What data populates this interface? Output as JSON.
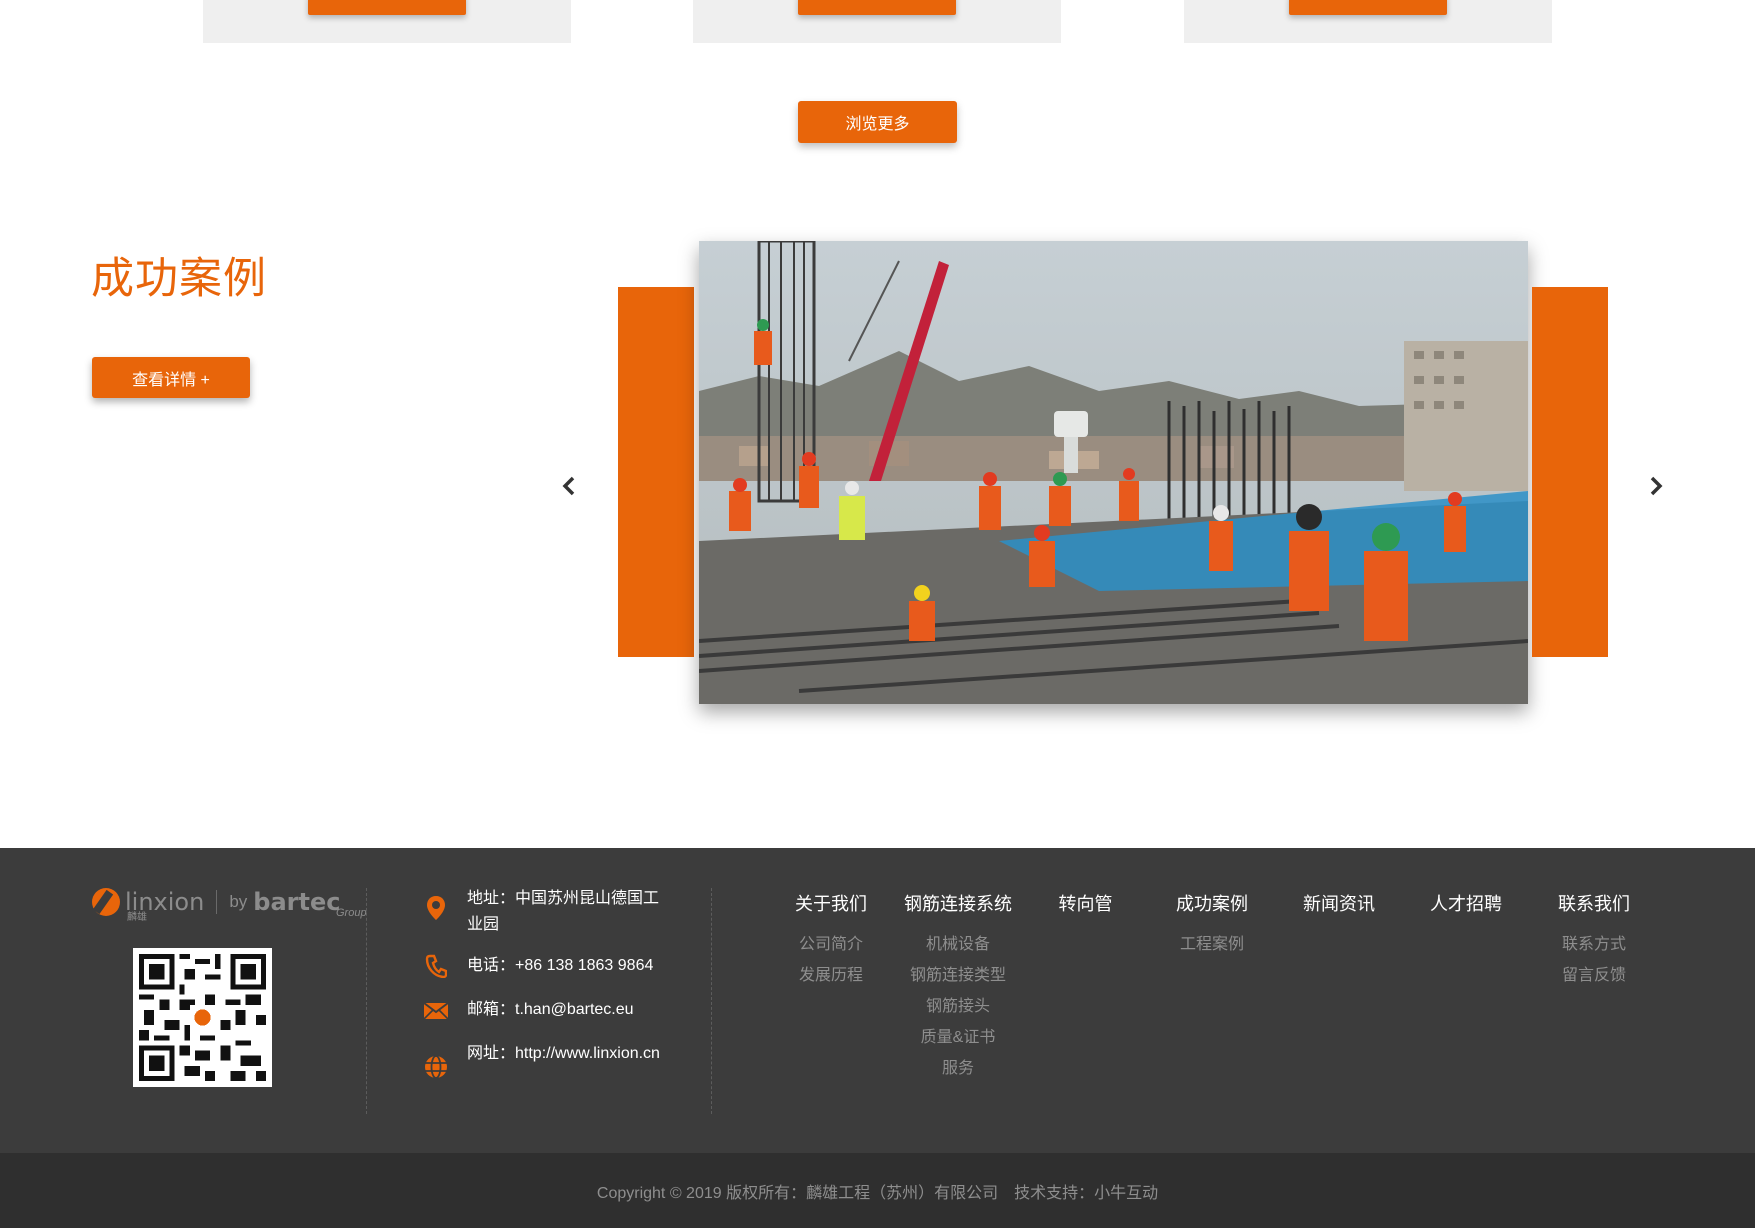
{
  "top_cards": {
    "buttons": [
      "",
      "",
      ""
    ]
  },
  "browse_more_label": "浏览更多",
  "cases": {
    "title": "成功案例",
    "details_label": "查看详情 +",
    "prev_icon": "chevron-left-icon",
    "next_icon": "chevron-right-icon",
    "slide_description_icon": "construction-site-photo"
  },
  "footer": {
    "logo": {
      "brand": "linxion",
      "brand_sub": "麟雄",
      "by": "by",
      "partner": "bartec",
      "partner_sub": "Group"
    },
    "contact": {
      "address": "地址：中国苏州昆山德国工业园",
      "phone": "电话：+86 138 1863 9864",
      "email": "邮箱：t.han@bartec.eu",
      "website": "网址：http://www.linxion.cn"
    },
    "nav": [
      {
        "label": "关于我们",
        "items": [
          "公司简介",
          "发展历程"
        ]
      },
      {
        "label": "钢筋连接系统",
        "items": [
          "机械设备",
          "钢筋连接类型",
          "钢筋接头",
          "质量&证书",
          "服务"
        ]
      },
      {
        "label": "转向管",
        "items": []
      },
      {
        "label": "成功案例",
        "items": [
          "工程案例"
        ]
      },
      {
        "label": "新闻资讯",
        "items": []
      },
      {
        "label": "人才招聘",
        "items": []
      },
      {
        "label": "联系我们",
        "items": [
          "联系方式",
          "留言反馈"
        ]
      }
    ],
    "copyright": "Copyright © 2019 版权所有：麟雄工程（苏州）有限公司",
    "tech_support": "技术支持：小牛互动"
  },
  "colors": {
    "accent": "#e8650a",
    "footer_bg": "#3c3c3c",
    "copyright_bg": "#2f2f2f"
  }
}
